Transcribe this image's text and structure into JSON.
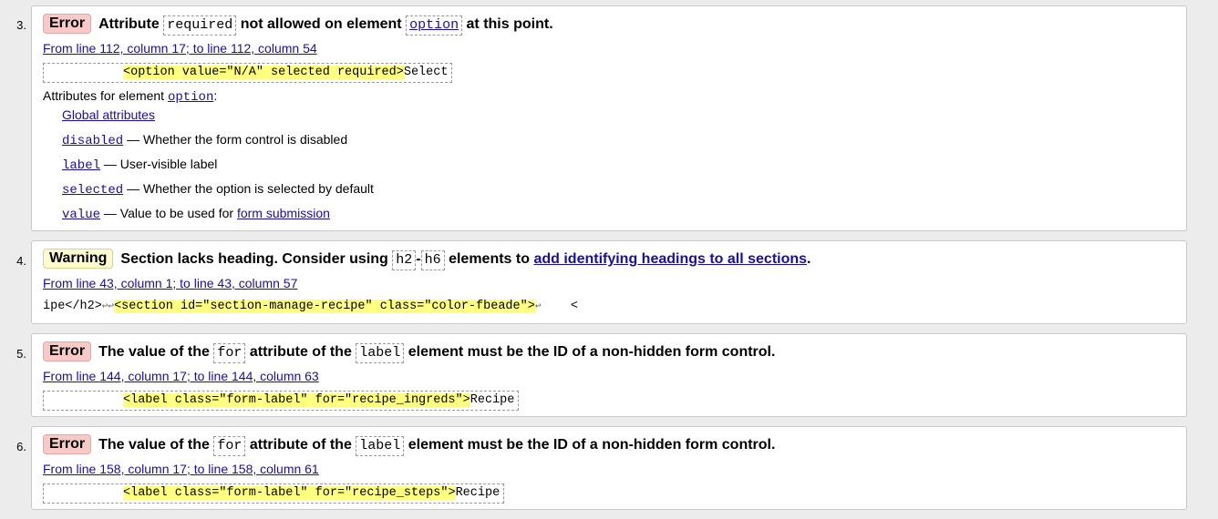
{
  "messages": [
    {
      "number": "3.",
      "type_label": "Error",
      "headline": {
        "part1": "Attribute",
        "code1": "required",
        "part2": "not allowed on element",
        "code2": "option",
        "part3": "at this point."
      },
      "location": "From line 112, column 17; to line 112, column 54",
      "extract": {
        "highlight": "<option value=\"N/A\" selected required>",
        "trailing": "Select"
      },
      "attributes_intro": "Attributes for element",
      "attributes_element": "option",
      "attributes_colon": ":",
      "attributes": [
        {
          "name": "Global attributes",
          "desc": "",
          "link_text": ""
        },
        {
          "name": "disabled",
          "desc": " — Whether the form control is disabled",
          "link_text": ""
        },
        {
          "name": "label",
          "desc": " — User-visible label",
          "link_text": ""
        },
        {
          "name": "selected",
          "desc": " — Whether the option is selected by default",
          "link_text": ""
        },
        {
          "name": "value",
          "desc": " — Value to be used for ",
          "link_text": "form submission"
        }
      ]
    },
    {
      "number": "4.",
      "type_label": "Warning",
      "headline": {
        "part1": "Section lacks heading. Consider using",
        "code1": "h2",
        "dash": "-",
        "code2": "h6",
        "part2": "elements to",
        "link": "add identifying headings to all sections",
        "part3": "."
      },
      "location": "From line 43, column 1; to line 43, column 57",
      "extract": {
        "leading": "ipe</h2>",
        "lf1": "↩↩",
        "highlight": "<section id=\"section-manage-recipe\" class=\"color-fbeade\">",
        "lf2": "↩",
        "trailing": "    <"
      }
    },
    {
      "number": "5.",
      "type_label": "Error",
      "headline": {
        "part1": "The value of the",
        "code1": "for",
        "part2": "attribute of the",
        "code2": "label",
        "part3": "element must be the ID of a non-hidden form control."
      },
      "location": "From line 144, column 17; to line 144, column 63",
      "extract": {
        "highlight": "<label class=\"form-label\" for=\"recipe_ingreds\">",
        "trailing": "Recipe"
      }
    },
    {
      "number": "6.",
      "type_label": "Error",
      "headline": {
        "part1": "The value of the",
        "code1": "for",
        "part2": "attribute of the",
        "code2": "label",
        "part3": "element must be the ID of a non-hidden form control."
      },
      "location": "From line 158, column 17; to line 158, column 61",
      "extract": {
        "highlight": "<label class=\"form-label\" for=\"recipe_steps\">",
        "trailing": "Recipe"
      }
    }
  ],
  "colors": {
    "error_badge": "#f7c9c7",
    "warning_badge": "#fffbd0",
    "link": "#1a0dab",
    "highlight": "#ffff80"
  }
}
